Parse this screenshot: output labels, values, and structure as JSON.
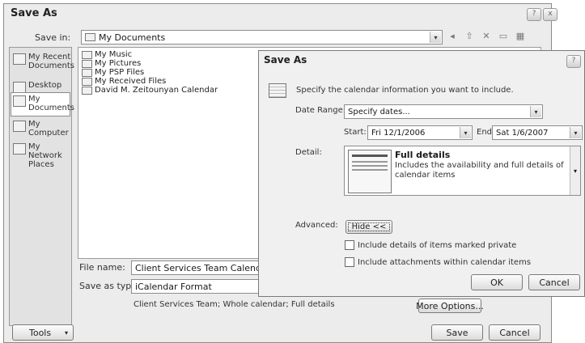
{
  "outer": {
    "title": "Save As",
    "save_in_label": "Save in:",
    "save_in_value": "My Documents",
    "places": [
      {
        "label": "My Recent Documents",
        "icon": "recent-documents-icon"
      },
      {
        "label": "Desktop",
        "icon": "desktop-icon"
      },
      {
        "label": "My Documents",
        "icon": "my-documents-icon"
      },
      {
        "label": "My Computer",
        "icon": "my-computer-icon"
      },
      {
        "label": "My Network Places",
        "icon": "network-places-icon"
      }
    ],
    "files": [
      "My Music",
      "My Pictures",
      "My PSP Files",
      "My Received Files",
      "David M. Zeitounyan Calendar"
    ],
    "file_name_label": "File name:",
    "file_name_value": "Client Services Team Calendar",
    "save_as_type_label": "Save as type:",
    "save_as_type_value": "iCalendar Format",
    "description": "Client Services Team; Whole calendar; Full details",
    "more_options_label": "More Options...",
    "tools_label": "Tools",
    "save_label": "Save",
    "cancel_label": "Cancel"
  },
  "inner": {
    "title": "Save As",
    "help_glyph": "?",
    "close_glyph": "x",
    "instruction": "Specify the calendar information you want to include.",
    "date_range_label": "Date Range:",
    "date_range_value": "Specify dates...",
    "start_label": "Start:",
    "start_value": "Fri 12/1/2006",
    "end_label": "End:",
    "end_value": "Sat 1/6/2007",
    "detail_label": "Detail:",
    "detail_title": "Full details",
    "detail_description": "Includes the availability and full details of calendar items",
    "advanced_label": "Advanced:",
    "hide_label": "Hide <<",
    "include_private_label": "Include details of items marked private",
    "include_attachments_label": "Include attachments within calendar items",
    "ok_label": "OK",
    "cancel_label": "Cancel"
  },
  "glyphs": {
    "dropdown_arrow": "▾",
    "tools_arrow": "▾"
  }
}
